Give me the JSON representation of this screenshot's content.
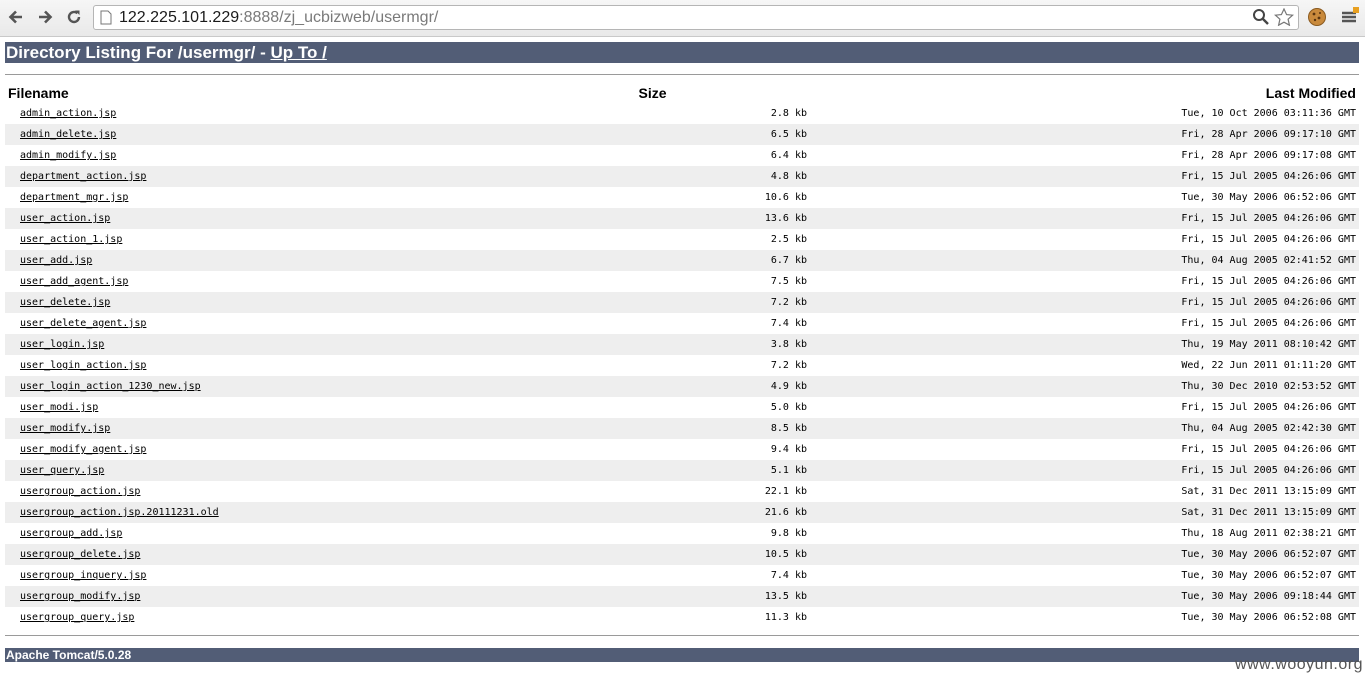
{
  "browser": {
    "url_host": "122.225.101.229",
    "url_rest": ":8888/zj_ucbizweb/usermgr/"
  },
  "page": {
    "heading_prefix": "Directory Listing For /usermgr/ - ",
    "up_link": "Up To /",
    "columns": {
      "filename": "Filename",
      "size": "Size",
      "modified": "Last Modified"
    },
    "footer": "Apache Tomcat/5.0.28"
  },
  "files": [
    {
      "name": "admin_action.jsp",
      "size": "2.8 kb",
      "modified": "Tue, 10 Oct 2006 03:11:36 GMT"
    },
    {
      "name": "admin_delete.jsp",
      "size": "6.5 kb",
      "modified": "Fri, 28 Apr 2006 09:17:10 GMT"
    },
    {
      "name": "admin_modify.jsp",
      "size": "6.4 kb",
      "modified": "Fri, 28 Apr 2006 09:17:08 GMT"
    },
    {
      "name": "department_action.jsp",
      "size": "4.8 kb",
      "modified": "Fri, 15 Jul 2005 04:26:06 GMT"
    },
    {
      "name": "department_mgr.jsp",
      "size": "10.6 kb",
      "modified": "Tue, 30 May 2006 06:52:06 GMT"
    },
    {
      "name": "user_action.jsp",
      "size": "13.6 kb",
      "modified": "Fri, 15 Jul 2005 04:26:06 GMT"
    },
    {
      "name": "user_action_1.jsp",
      "size": "2.5 kb",
      "modified": "Fri, 15 Jul 2005 04:26:06 GMT"
    },
    {
      "name": "user_add.jsp",
      "size": "6.7 kb",
      "modified": "Thu, 04 Aug 2005 02:41:52 GMT"
    },
    {
      "name": "user_add_agent.jsp",
      "size": "7.5 kb",
      "modified": "Fri, 15 Jul 2005 04:26:06 GMT"
    },
    {
      "name": "user_delete.jsp",
      "size": "7.2 kb",
      "modified": "Fri, 15 Jul 2005 04:26:06 GMT"
    },
    {
      "name": "user_delete_agent.jsp",
      "size": "7.4 kb",
      "modified": "Fri, 15 Jul 2005 04:26:06 GMT"
    },
    {
      "name": "user_login.jsp",
      "size": "3.8 kb",
      "modified": "Thu, 19 May 2011 08:10:42 GMT"
    },
    {
      "name": "user_login_action.jsp",
      "size": "7.2 kb",
      "modified": "Wed, 22 Jun 2011 01:11:20 GMT"
    },
    {
      "name": "user_login_action_1230_new.jsp",
      "size": "4.9 kb",
      "modified": "Thu, 30 Dec 2010 02:53:52 GMT"
    },
    {
      "name": "user_modi.jsp",
      "size": "5.0 kb",
      "modified": "Fri, 15 Jul 2005 04:26:06 GMT"
    },
    {
      "name": "user_modify.jsp",
      "size": "8.5 kb",
      "modified": "Thu, 04 Aug 2005 02:42:30 GMT"
    },
    {
      "name": "user_modify_agent.jsp",
      "size": "9.4 kb",
      "modified": "Fri, 15 Jul 2005 04:26:06 GMT"
    },
    {
      "name": "user_query.jsp",
      "size": "5.1 kb",
      "modified": "Fri, 15 Jul 2005 04:26:06 GMT"
    },
    {
      "name": "usergroup_action.jsp",
      "size": "22.1 kb",
      "modified": "Sat, 31 Dec 2011 13:15:09 GMT"
    },
    {
      "name": "usergroup_action.jsp.20111231.old",
      "size": "21.6 kb",
      "modified": "Sat, 31 Dec 2011 13:15:09 GMT"
    },
    {
      "name": "usergroup_add.jsp",
      "size": "9.8 kb",
      "modified": "Thu, 18 Aug 2011 02:38:21 GMT"
    },
    {
      "name": "usergroup_delete.jsp",
      "size": "10.5 kb",
      "modified": "Tue, 30 May 2006 06:52:07 GMT"
    },
    {
      "name": "usergroup_inquery.jsp",
      "size": "7.4 kb",
      "modified": "Tue, 30 May 2006 06:52:07 GMT"
    },
    {
      "name": "usergroup_modify.jsp",
      "size": "13.5 kb",
      "modified": "Tue, 30 May 2006 09:18:44 GMT"
    },
    {
      "name": "usergroup_query.jsp",
      "size": "11.3 kb",
      "modified": "Tue, 30 May 2006 06:52:08 GMT"
    }
  ],
  "watermark": "www.wooyun.org"
}
